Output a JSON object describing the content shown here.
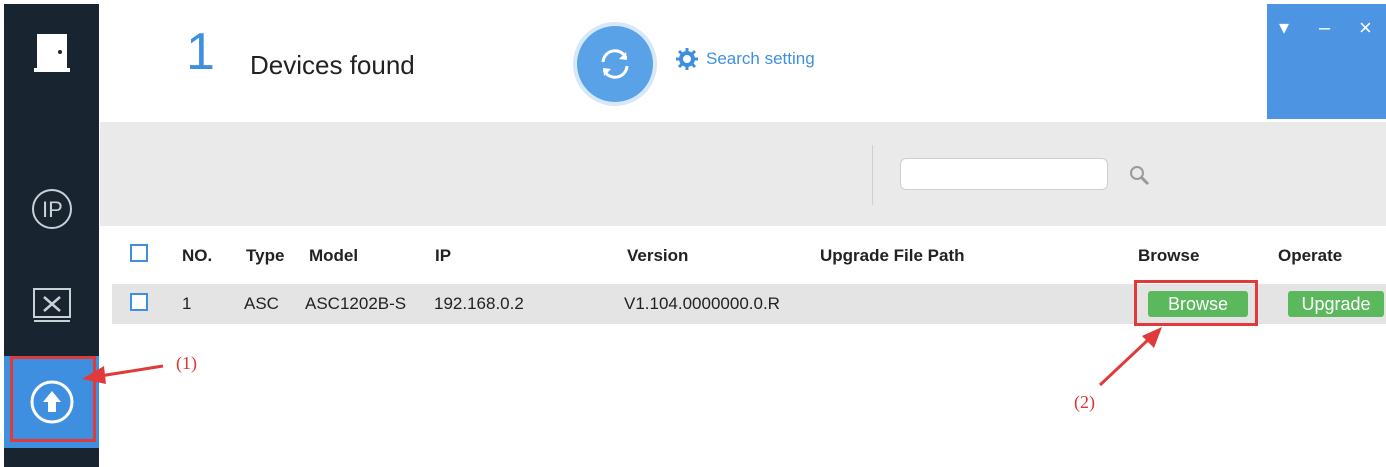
{
  "header": {
    "device_count": "1",
    "found_label": "Devices found",
    "search_setting_label": "Search setting"
  },
  "window_controls": {
    "menu_icon": "▾",
    "minimize_icon": "–",
    "close_icon": "×"
  },
  "toolbar": {
    "search_value": "",
    "search_placeholder": ""
  },
  "table": {
    "columns": [
      "NO.",
      "Type",
      "Model",
      "IP",
      "Version",
      "Upgrade File Path",
      "Browse",
      "Operate"
    ],
    "rows": [
      {
        "no": "1",
        "type": "ASC",
        "model": "ASC1202B-S",
        "ip": "192.168.0.2",
        "version": "V1.104.0000000.0.R",
        "upgrade_file_path": "",
        "browse_label": "Browse",
        "operate_label": "Upgrade"
      }
    ]
  },
  "annotations": {
    "label_1": "(1)",
    "label_2": "(2)"
  },
  "colors": {
    "accent": "#3f8fe0",
    "sidebar": "#182430",
    "green_button": "#5cb85c",
    "annotation_red": "#e03a3a"
  },
  "icons": {
    "sidebar": [
      "door-icon",
      "ip-icon",
      "tools-icon",
      "upgrade-icon"
    ],
    "header": [
      "refresh-icon",
      "gear-icon"
    ],
    "toolbar": [
      "search-icon"
    ]
  }
}
